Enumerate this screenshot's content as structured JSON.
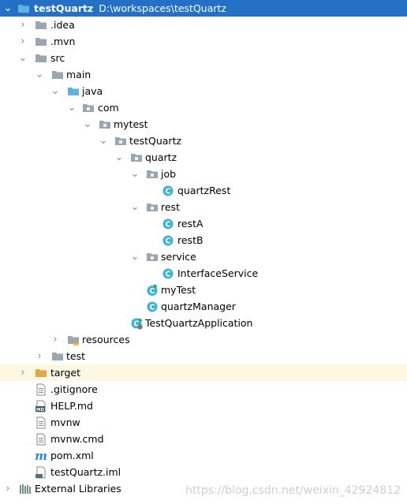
{
  "project": {
    "name": "testQuartz",
    "path": "D:\\workspaces\\testQuartz"
  },
  "nodes": {
    "idea": ".idea",
    "mvn": ".mvn",
    "src": "src",
    "main": "main",
    "java": "java",
    "com": "com",
    "mytest": "mytest",
    "testQuartz": "testQuartz",
    "quartz": "quartz",
    "job": "job",
    "quartzRest": "quartzRest",
    "rest": "rest",
    "restA": "restA",
    "restB": "restB",
    "service": "service",
    "interfaceService": "InterfaceService",
    "myTest": "myTest",
    "quartzManager": "quartzManager",
    "testQuartzApplication": "TestQuartzApplication",
    "resources": "resources",
    "test": "test",
    "target": "target",
    "gitignore": ".gitignore",
    "helpMd": "HELP.md",
    "mvnw": "mvnw",
    "mvnwCmd": "mvnw.cmd",
    "pomXml": "pom.xml",
    "iml": "testQuartz.iml",
    "externalLibraries": "External Libraries"
  },
  "watermark": "https://blog.csdn.net/weixin_42924812",
  "colors": {
    "selection": "#2470c6",
    "folder": "#90a4ae",
    "source_folder": "#62b2e0",
    "class_icon": "#3db3d6",
    "target_folder": "#e5a645",
    "highlight_row": "#fdf8e3"
  },
  "icons": {
    "collapsed": "chevron-right",
    "expanded": "chevron-down"
  }
}
